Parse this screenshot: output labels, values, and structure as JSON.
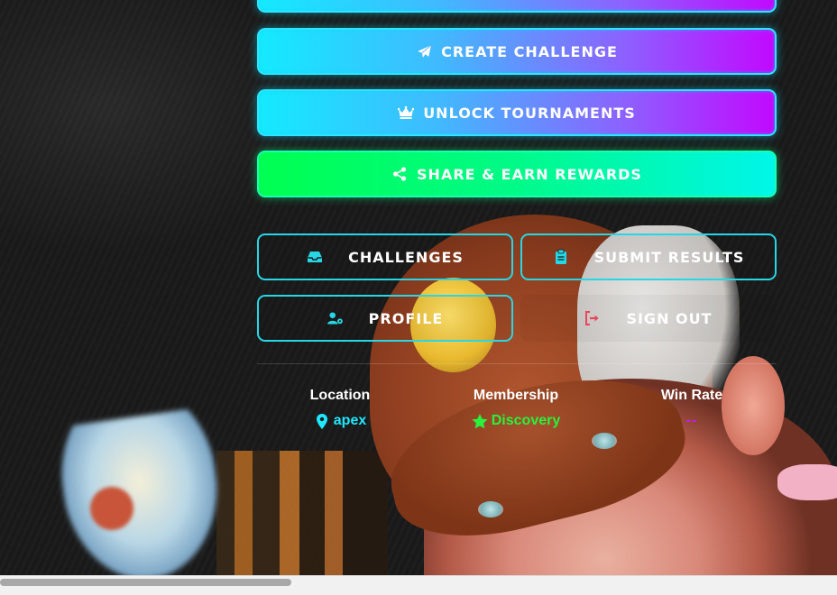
{
  "buttons": {
    "create_challenge": "CREATE CHALLENGE",
    "unlock_tournaments": "UNLOCK TOURNAMENTS",
    "share_earn": "SHARE & EARN REWARDS",
    "challenges": "CHALLENGES",
    "submit_results": "SUBMIT RESULTS",
    "profile": "PROFILE",
    "sign_out": "SIGN OUT"
  },
  "icons": {
    "create_challenge": "paper-plane-icon",
    "unlock_tournaments": "crown-icon",
    "share_earn": "share-nodes-icon",
    "challenges": "inbox-tray-icon",
    "submit_results": "clipboard-icon",
    "profile": "user-gear-icon",
    "sign_out": "sign-out-icon"
  },
  "stats": {
    "location": {
      "label": "Location",
      "value": "apex"
    },
    "membership": {
      "label": "Membership",
      "value": "Discovery"
    },
    "win_rate": {
      "label": "Win Rate",
      "value": "--"
    }
  },
  "colors": {
    "cyan": "#14eaff",
    "purple": "#c208ff",
    "green": "#00ff51",
    "outline": "#27d7e6",
    "signout_icon": "#e8465a",
    "location_value": "#1fe8ff",
    "membership_value": "#28f23c",
    "winrate_value": "#c51bff"
  }
}
